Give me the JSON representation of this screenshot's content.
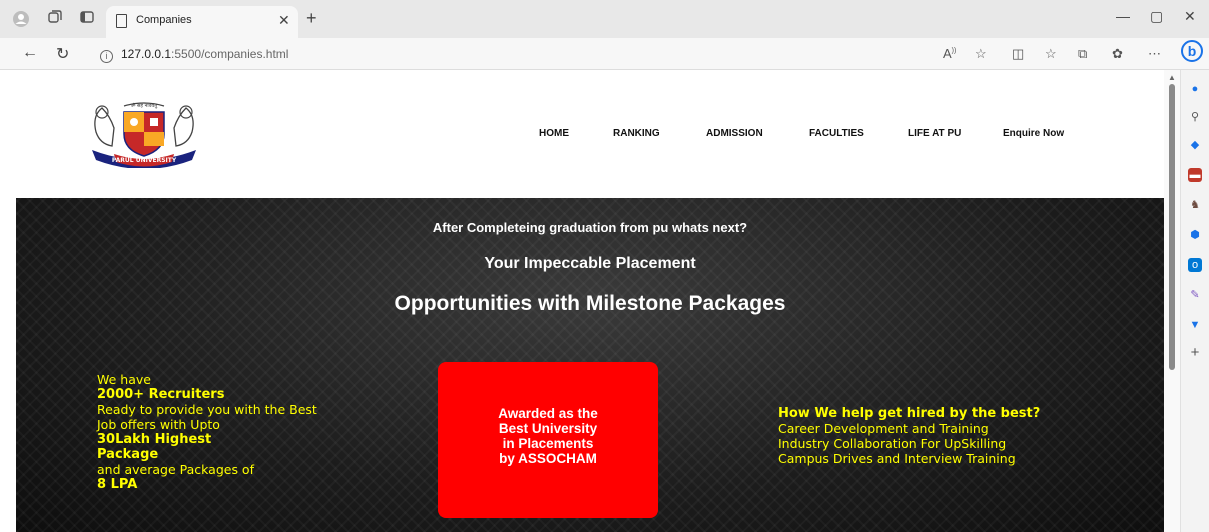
{
  "browser": {
    "tab_title": "Companies",
    "url_host": "127.0.0.1",
    "url_rest": ":5500/companies.html",
    "reader_label": "A",
    "accent": "#1a73e8"
  },
  "site": {
    "logo_motto": "ॐ सह नाववतु",
    "logo_name": "PARUL UNIVERSITY",
    "nav": [
      "HOME",
      "RANKING",
      "ADMISSION",
      "FACULTIES",
      "LIFE AT PU",
      "Enquire Now"
    ]
  },
  "hero": {
    "line1": "After Completeing graduation from pu whats next?",
    "line2": "Your Impeccable Placement",
    "line3": "Opportunities with Milestone Packages",
    "left": {
      "l1": "We have",
      "l2": "2000+ Recruiters",
      "l3": "Ready to provide you with the Best",
      "l4": "Job offers with Upto",
      "l5": "30Lakh Highest",
      "l6": "Package",
      "l7": "and average Packages of",
      "l8": "8 LPA"
    },
    "award": {
      "l1": "Awarded as the",
      "l2": "Best University",
      "l3": "in Placements",
      "l4": "by ASSOCHAM"
    },
    "right": {
      "heading": "How We help get hired by the best?",
      "l1": "Career Development and Training",
      "l2": "Industry Collaboration For UpSkilling",
      "l3": "Campus Drives and Interview Training"
    },
    "text_color": "#ffff00",
    "award_color": "#ff0000"
  }
}
